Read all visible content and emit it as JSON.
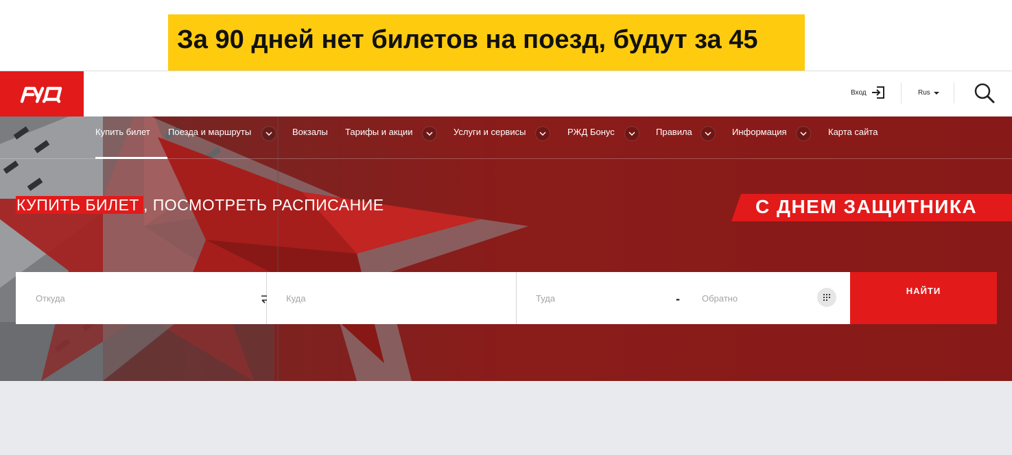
{
  "caption": {
    "text": "За 90 дней нет билетов на поезд, будут за 45"
  },
  "header": {
    "login_label": "Вход",
    "lang_label": "Rus"
  },
  "nav": {
    "items": [
      {
        "label": "Купить билет",
        "has_dropdown": false,
        "active": true
      },
      {
        "label": "Поезда и маршруты",
        "has_dropdown": true
      },
      {
        "label": "Вокзалы",
        "has_dropdown": false
      },
      {
        "label": "Тарифы и акции",
        "has_dropdown": true
      },
      {
        "label": "Услуги и сервисы",
        "has_dropdown": true
      },
      {
        "label": "РЖД Бонус",
        "has_dropdown": true
      },
      {
        "label": "Правила",
        "has_dropdown": true
      },
      {
        "label": "Информация",
        "has_dropdown": true
      },
      {
        "label": "Карта сайта",
        "has_dropdown": false
      }
    ]
  },
  "hero": {
    "title_highlight": "КУПИТЬ БИЛЕТ",
    "title_rest": ", ПОСМОТРЕТЬ РАСПИСАНИЕ",
    "promo": "С ДНЕМ ЗАЩИТНИКА"
  },
  "search": {
    "from_placeholder": "Откуда",
    "to_placeholder": "Куда",
    "date_there_placeholder": "Туда",
    "date_back_placeholder": "Обратно",
    "date_separator": "-",
    "submit_label": "НАЙТИ"
  },
  "colors": {
    "brand_red": "#e21a1a",
    "caption_yellow": "#fecb0e",
    "hero_bg": "#8e1b19",
    "page_bg": "#e9eaed"
  }
}
